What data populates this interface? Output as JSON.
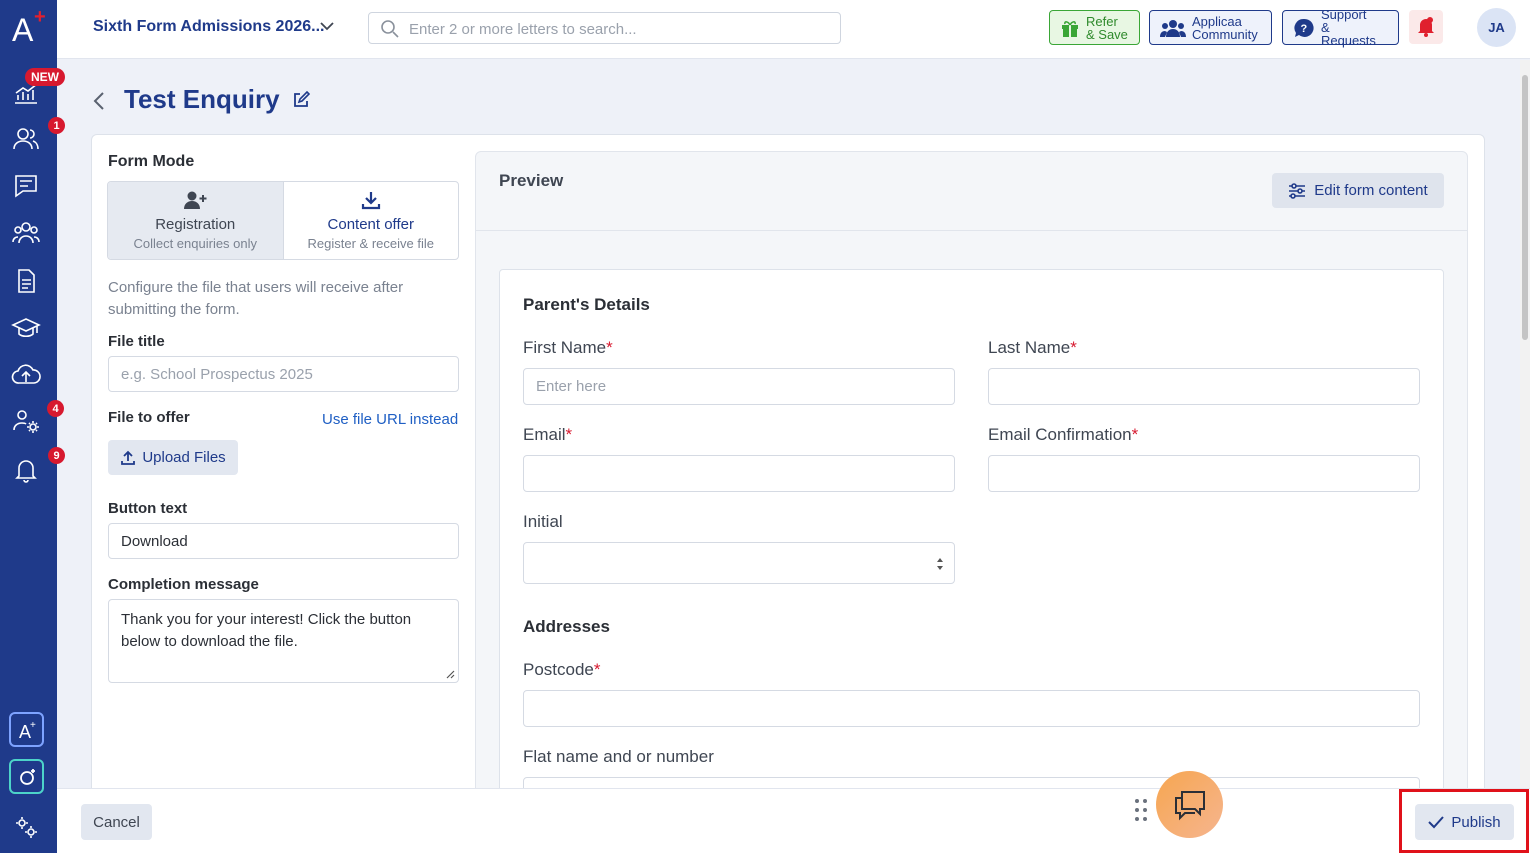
{
  "sidebar": {
    "new_badge": "NEW",
    "badges": {
      "people": "1",
      "staff": "4",
      "notifications": "9"
    }
  },
  "topbar": {
    "title": "Sixth Form Admissions 2026...",
    "search_placeholder": "Enter 2 or more letters to search...",
    "refer": [
      "Refer",
      "& Save"
    ],
    "community": [
      "Applicaa",
      "Community"
    ],
    "support": [
      "Support",
      "& Requests"
    ],
    "avatar": "JA"
  },
  "page": {
    "title": "Test Enquiry"
  },
  "left_panel": {
    "form_mode_label": "Form Mode",
    "modes": [
      {
        "title": "Registration",
        "sub": "Collect enquiries only",
        "selected": false
      },
      {
        "title": "Content offer",
        "sub": "Register & receive file",
        "selected": true
      }
    ],
    "description": "Configure the file that users will receive after submitting the form.",
    "file_title_label": "File title",
    "file_title_placeholder": "e.g. School Prospectus 2025",
    "file_offer_label": "File to offer",
    "file_url_link": "Use file URL instead",
    "upload_label": "Upload Files",
    "button_text_label": "Button text",
    "button_text_value": "Download",
    "completion_label": "Completion message",
    "completion_value": "Thank you for your interest! Click the button below to download the file."
  },
  "preview": {
    "title": "Preview",
    "edit_button": "Edit form content",
    "sections": {
      "parent": "Parent's Details",
      "addresses": "Addresses"
    },
    "fields": {
      "first_name": "First Name",
      "first_name_placeholder": "Enter here",
      "last_name": "Last Name",
      "email": "Email",
      "email_confirm": "Email Confirmation",
      "initial": "Initial",
      "postcode": "Postcode",
      "flat": "Flat name and or number"
    },
    "required_mark": "*"
  },
  "footer": {
    "cancel": "Cancel",
    "publish": "Publish"
  },
  "colors": {
    "brand": "#1f3a8a",
    "danger": "#d7192f",
    "highlight": "#e0111a"
  }
}
